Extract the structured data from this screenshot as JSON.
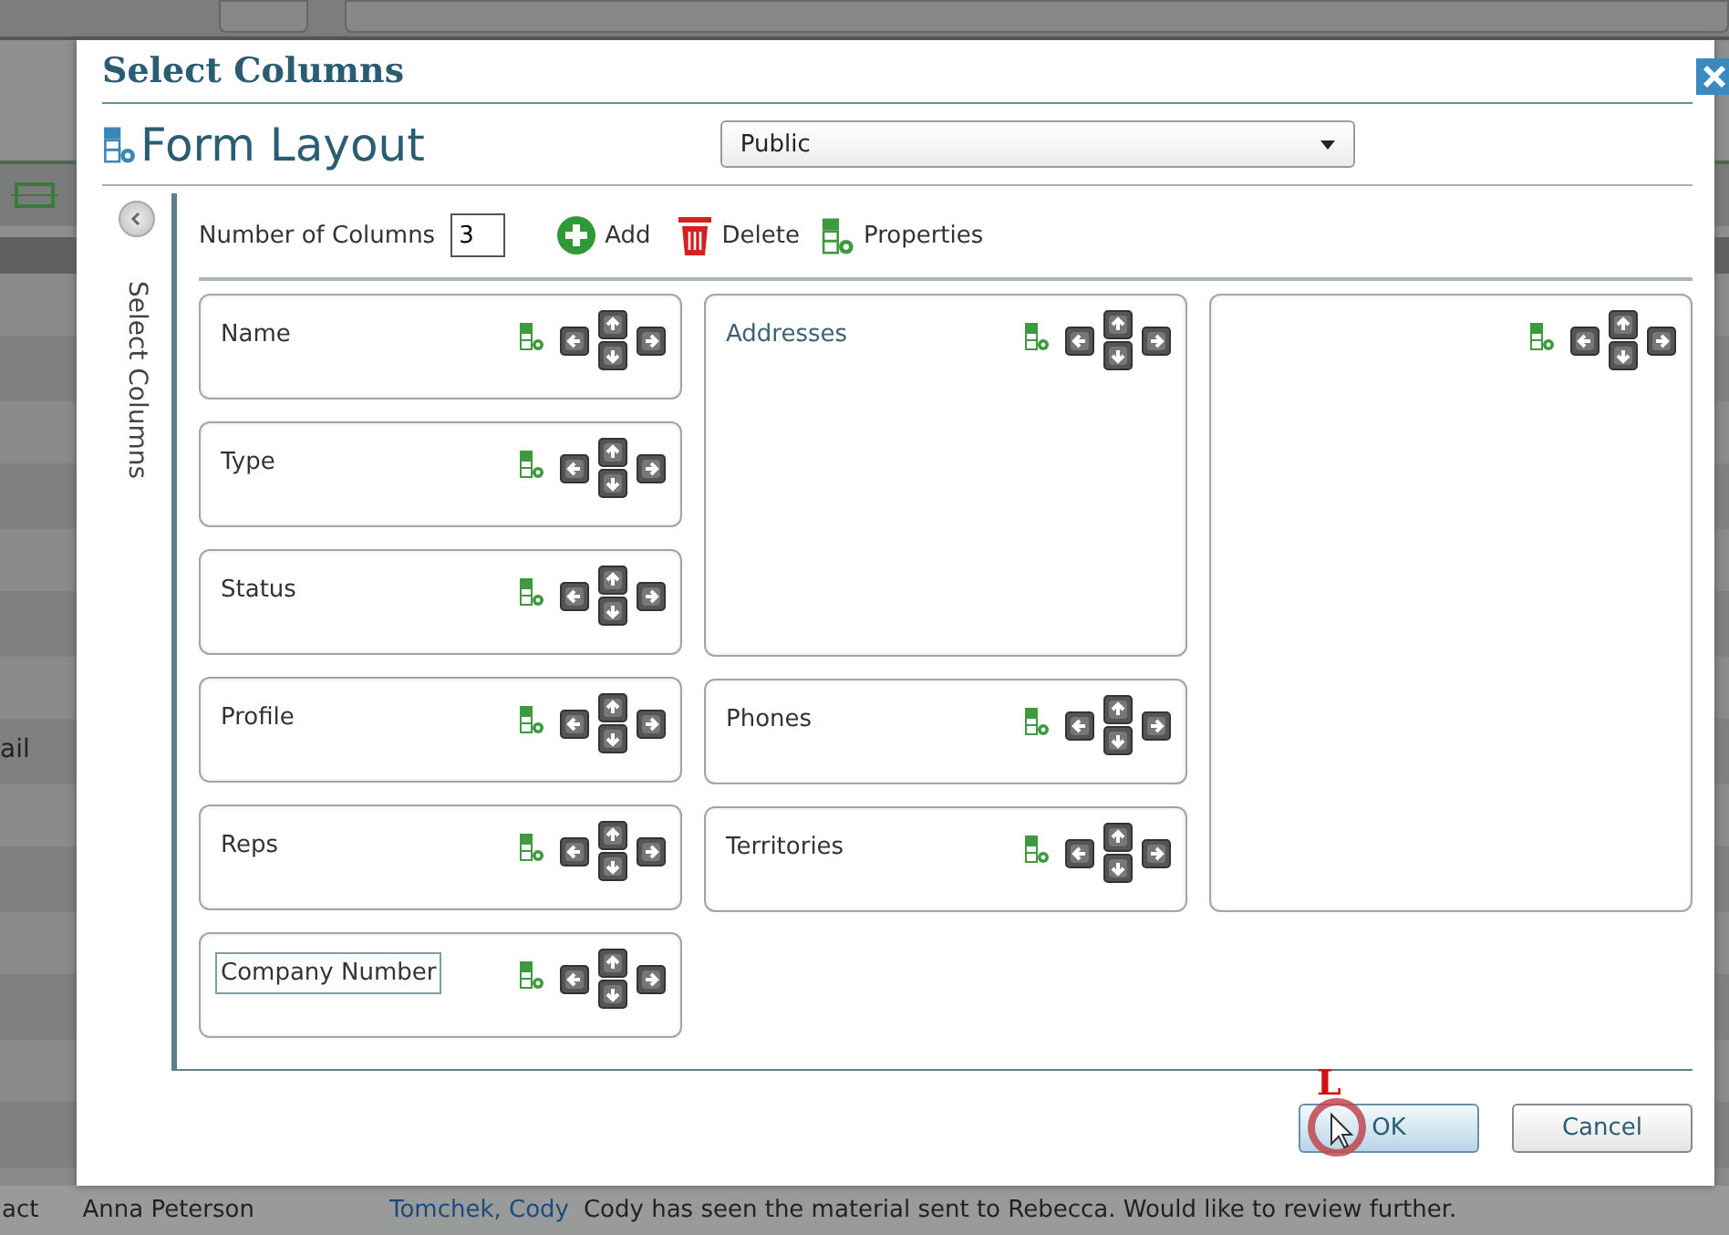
{
  "background": {
    "side_label": "ail",
    "row": [
      "act",
      "Anna Peterson",
      "Tomchek, Cody",
      "Cody has seen the material sent to Rebecca.  Would like to review further."
    ]
  },
  "dialog": {
    "title": "Select Columns",
    "heading": "Form Layout",
    "layout_select": {
      "value": "Public"
    },
    "sidebar": {
      "label": "Select Columns",
      "expanded": true
    },
    "toolbar": {
      "columns_label": "Number of Columns",
      "columns_value": "3",
      "actions": [
        {
          "kind": "add",
          "label": "Add"
        },
        {
          "kind": "delete",
          "label": "Delete"
        },
        {
          "kind": "properties",
          "label": "Properties"
        }
      ]
    },
    "columns": [
      {
        "fields": [
          {
            "label": "Name",
            "kind": "short",
            "focused": false
          },
          {
            "label": "Type",
            "kind": "short",
            "focused": false
          },
          {
            "label": "Status",
            "kind": "short",
            "focused": false
          },
          {
            "label": "Profile",
            "kind": "short",
            "focused": false
          },
          {
            "label": "Reps",
            "kind": "short",
            "focused": false
          },
          {
            "label": "Company Number",
            "kind": "short",
            "focused": true
          }
        ]
      },
      {
        "fields": [
          {
            "label": "Addresses",
            "kind": "tall",
            "focused": false
          },
          {
            "label": "Phones",
            "kind": "short",
            "focused": false
          },
          {
            "label": "Territories",
            "kind": "short",
            "focused": false
          }
        ]
      },
      {
        "fields": [
          {
            "kind": "full"
          }
        ]
      }
    ],
    "buttons": [
      {
        "label": "OK",
        "selected": true
      },
      {
        "label": "Cancel",
        "selected": false
      }
    ],
    "click_marker": "L"
  }
}
